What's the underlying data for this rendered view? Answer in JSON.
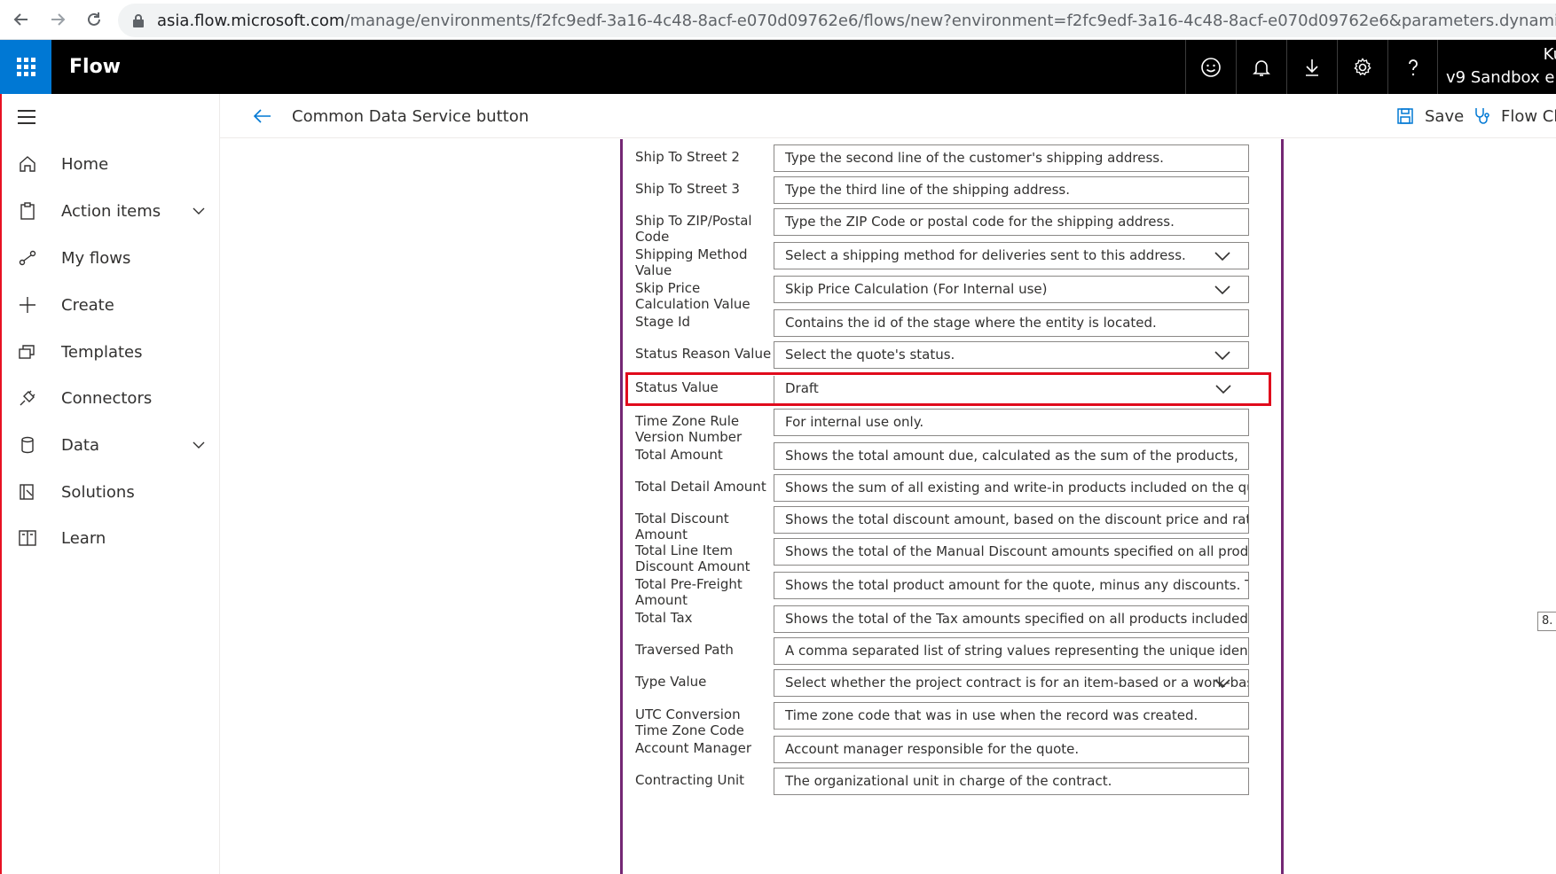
{
  "browser": {
    "url_host": "asia.flow.microsoft.com",
    "url_rest": "/manage/environments/f2fc9edf-3a16-4c48-8acf-e070d09762e6/flows/new?environment=f2fc9edf-3a16-4c48-8acf-e070d09762e6&parameters.dynamicscrmonline.organizationNam"
  },
  "appbar": {
    "title": "Flow",
    "user_name": "Ku",
    "environment": "v9 Sandbox env",
    "icons": [
      "smiley-icon",
      "bell-icon",
      "download-icon",
      "gear-icon",
      "help-icon"
    ]
  },
  "sidebar": {
    "items": [
      {
        "label": "Home",
        "icon": "home-icon"
      },
      {
        "label": "Action items",
        "icon": "clipboard-icon",
        "expandable": true
      },
      {
        "label": "My flows",
        "icon": "flow-icon"
      },
      {
        "label": "Create",
        "icon": "plus-icon"
      },
      {
        "label": "Templates",
        "icon": "templates-icon"
      },
      {
        "label": "Connectors",
        "icon": "plug-icon"
      },
      {
        "label": "Data",
        "icon": "database-icon",
        "expandable": true
      },
      {
        "label": "Solutions",
        "icon": "solutions-icon"
      },
      {
        "label": "Learn",
        "icon": "book-icon"
      }
    ]
  },
  "cmdbar": {
    "title": "Common Data Service button",
    "save_label": "Save",
    "checker_label": "Flow Ch"
  },
  "fields": [
    {
      "label": "Ship To Street 2",
      "value": "Type the second line of the customer's shipping address.",
      "dropdown": false
    },
    {
      "label": "Ship To Street 3",
      "value": "Type the third line of the shipping address.",
      "dropdown": false
    },
    {
      "label": "Ship To ZIP/Postal Code",
      "value": "Type the ZIP Code or postal code for the shipping address.",
      "dropdown": false
    },
    {
      "label": "Shipping Method Value",
      "value": "Select a shipping method for deliveries sent to this address.",
      "dropdown": true
    },
    {
      "label": "Skip Price Calculation Value",
      "value": "Skip Price Calculation (For Internal use)",
      "dropdown": true
    },
    {
      "label": "Stage Id",
      "value": "Contains the id of the stage where the entity is located.",
      "dropdown": false
    },
    {
      "label": "Status Reason Value",
      "value": "Select the quote's status.",
      "dropdown": true
    },
    {
      "label": "Status Value",
      "value": "Draft",
      "dropdown": true,
      "highlighted": true
    },
    {
      "label": "Time Zone Rule Version Number",
      "value": "For internal use only.",
      "dropdown": false
    },
    {
      "label": "Total Amount",
      "value": "Shows the total amount due, calculated as the sum of the products,",
      "dropdown": false
    },
    {
      "label": "Total Detail Amount",
      "value": "Shows the sum of all existing and write-in products included on the quote,",
      "dropdown": false
    },
    {
      "label": "Total Discount Amount",
      "value": "Shows the total discount amount, based on the discount price and rate",
      "dropdown": false
    },
    {
      "label": "Total Line Item Discount Amount",
      "value": "Shows the total of the Manual Discount amounts specified on all products",
      "dropdown": false
    },
    {
      "label": "Total Pre-Freight Amount",
      "value": "Shows the total product amount for the quote, minus any discounts. This",
      "dropdown": false
    },
    {
      "label": "Total Tax",
      "value": "Shows the total of the Tax amounts specified on all products included in the",
      "dropdown": false
    },
    {
      "label": "Traversed Path",
      "value": "A comma separated list of string values representing the unique identifiers of",
      "dropdown": false
    },
    {
      "label": "Type Value",
      "value": "Select whether the project contract is for an item-based or a work-base",
      "dropdown": true
    },
    {
      "label": "UTC Conversion Time Zone Code",
      "value": "Time zone code that was in use when the record was created.",
      "dropdown": false
    },
    {
      "label": "Account Manager",
      "value": "Account manager responsible for the quote.",
      "dropdown": false
    },
    {
      "label": "Contracting Unit",
      "value": "The organizational unit in charge of the contract.",
      "dropdown": false
    }
  ],
  "side_badge": "8."
}
